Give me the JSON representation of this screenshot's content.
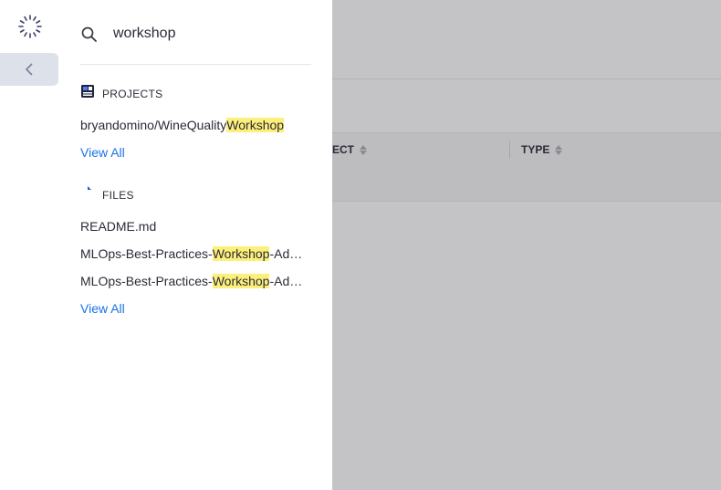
{
  "search": {
    "query": "workshop",
    "placeholder": ""
  },
  "projects": {
    "header": "PROJECTS",
    "icon": "projects-icon",
    "results": [
      {
        "prefix": "bryandomino/WineQuality",
        "match": "Workshop",
        "suffix": ""
      }
    ],
    "view_all": "View All"
  },
  "files": {
    "header": "FILES",
    "icon": "file-icon",
    "results": [
      {
        "prefix": "README.md",
        "match": "",
        "suffix": ""
      },
      {
        "prefix": "MLOps-Best-Practices-",
        "match": "Workshop",
        "suffix": "-Admin-Guide"
      },
      {
        "prefix": "MLOps-Best-Practices-",
        "match": "Workshop",
        "suffix": "-Admin-Guide"
      }
    ],
    "view_all": "View All"
  },
  "background_table": {
    "columns": [
      {
        "label": "ECT"
      },
      {
        "label": "TYPE"
      }
    ]
  },
  "colors": {
    "accent": "#1a73e8",
    "highlight": "#fdf07a",
    "overlay": "#c4c4c7"
  }
}
